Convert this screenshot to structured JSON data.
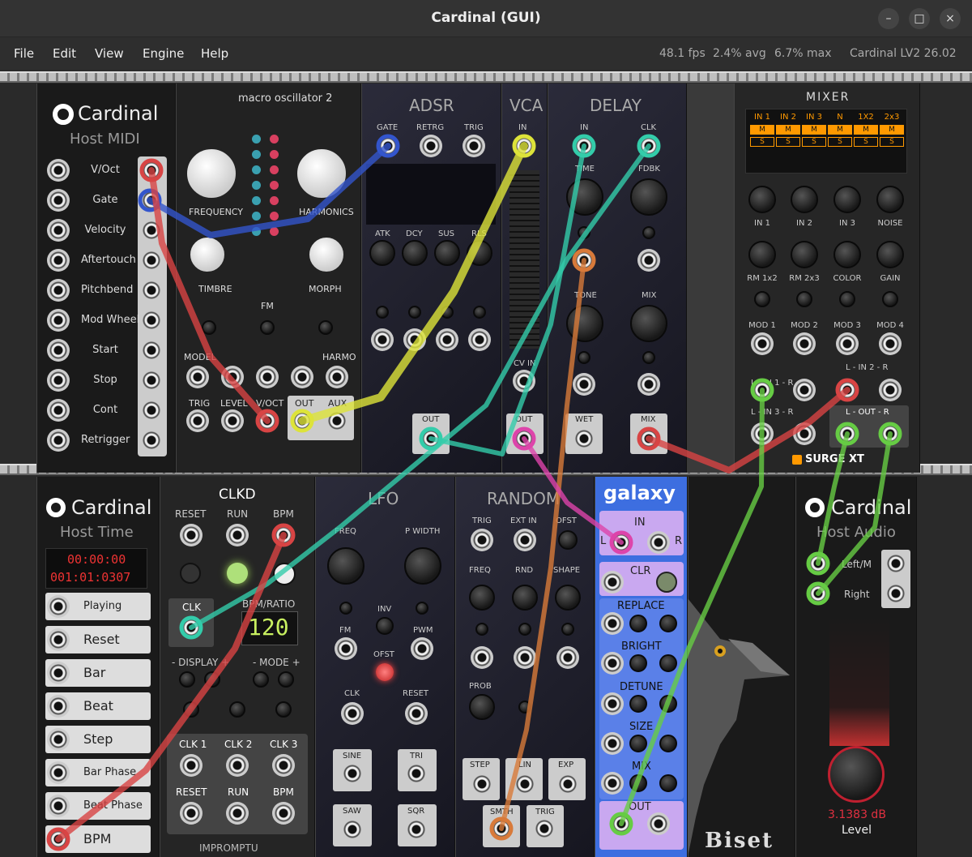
{
  "window": {
    "title": "Cardinal (GUI)",
    "buttons": [
      "–",
      "□",
      "×"
    ]
  },
  "menu": [
    "File",
    "Edit",
    "View",
    "Engine",
    "Help"
  ],
  "status": {
    "fps": "48.1 fps",
    "avg": "2.4% avg",
    "max": "6.7% max",
    "version": "Cardinal LV2 26.02"
  },
  "colors": {
    "red": "#d84444",
    "blue": "#3355cc",
    "yellow": "#dde33a",
    "teal": "#33ccaa",
    "orange": "#d87a3a",
    "green": "#66cc44",
    "pink": "#dd44aa"
  },
  "host_midi": {
    "brand": "Cardinal",
    "title": "Host MIDI",
    "rows": [
      "V/Oct",
      "Gate",
      "Velocity",
      "Aftertouch",
      "Pitchbend",
      "Mod Wheel",
      "Start",
      "Stop",
      "Cont",
      "Retrigger"
    ]
  },
  "macro": {
    "title": "macro oscillator 2",
    "frequency": "FREQUENCY",
    "harmonics": "HARMONICS",
    "timbre": "TIMBRE",
    "morph": "MORPH",
    "fm": "FM",
    "model": "MODEL",
    "harmo": "HARMO",
    "trig": "TRIG",
    "level": "LEVEL",
    "voct": "V/OCT",
    "out": "OUT",
    "aux": "AUX"
  },
  "adsr": {
    "title": "ADSR",
    "gate": "GATE",
    "retrg": "RETRG",
    "trig": "TRIG",
    "atk": "ATK",
    "dcy": "DCY",
    "sus": "SUS",
    "rls": "RLS",
    "out": "OUT"
  },
  "vca": {
    "title": "VCA",
    "in": "IN",
    "cvin": "CV IN",
    "out": "OUT"
  },
  "delay": {
    "title": "DELAY",
    "in": "IN",
    "clk": "CLK",
    "time": "TIME",
    "fdbk": "FDBK",
    "tone": "TONE",
    "mix": "MIX",
    "wet": "WET",
    "mixout": "MIX"
  },
  "mixer": {
    "title": "MIXER",
    "chan": [
      "IN 1",
      "IN 2",
      "IN 3",
      "N",
      "1X2",
      "2x3"
    ],
    "mute": "M",
    "solo": "S",
    "knobs1": [
      "IN 1",
      "IN 2",
      "IN 3",
      "NOISE"
    ],
    "knobs2": [
      "RM 1x2",
      "RM 2x3",
      "COLOR",
      "GAIN"
    ],
    "mods": [
      "MOD 1",
      "MOD 2",
      "MOD 3",
      "MOD 4"
    ],
    "lin1": "L - IN 1 - R",
    "lin2": "L - IN 2 - R",
    "lin3": "L - IN 3 - R",
    "lout": "L - OUT - R",
    "brand": "SURGE XT"
  },
  "host_time": {
    "brand": "Cardinal",
    "title": "Host Time",
    "time": "00:00:00",
    "bbt": "001:01:0307",
    "rows": [
      "Playing",
      "Reset",
      "Bar",
      "Beat",
      "Step",
      "Bar Phase",
      "Beat Phase",
      "BPM"
    ]
  },
  "clkd": {
    "title": "CLKD",
    "reset": "RESET",
    "run": "RUN",
    "bpm": "BPM",
    "clk": "CLK",
    "ratio": "BPM/RATIO",
    "display": "120",
    "disp": "- DISPLAY +",
    "mode": "- MODE +",
    "clk1": "CLK 1",
    "clk2": "CLK 2",
    "clk3": "CLK 3",
    "reset2": "RESET",
    "run2": "RUN",
    "bpm2": "BPM",
    "brand": "IMPROMPTU"
  },
  "lfo": {
    "title": "LFO",
    "freq": "FREQ",
    "pwidth": "P WIDTH",
    "inv": "INV",
    "fm": "FM",
    "pwm": "PWM",
    "ofst": "OFST",
    "clk": "CLK",
    "reset": "RESET",
    "sine": "SINE",
    "tri": "TRI",
    "saw": "SAW",
    "sqr": "SQR"
  },
  "random": {
    "title": "RANDOM",
    "trig": "TRIG",
    "extin": "EXT IN",
    "ofst": "OFST",
    "freq": "FREQ",
    "rnd": "RND",
    "shape": "SHAPE",
    "prob": "PROB",
    "step": "STEP",
    "lin": "LIN",
    "exp": "EXP",
    "smth": "SMTH",
    "trig2": "TRIG"
  },
  "galaxy": {
    "title": "galaxy",
    "in": "IN",
    "l": "L",
    "r": "R",
    "clr": "CLR",
    "replace": "REPLACE",
    "bright": "BRIGHT",
    "detune": "DETUNE",
    "size": "SIZE",
    "mix": "MIX",
    "out": "OUT"
  },
  "host_audio": {
    "brand": "Cardinal",
    "title": "Host Audio",
    "left": "Left/M",
    "right": "Right",
    "db": "3.1383 dB",
    "level": "Level"
  },
  "biset": {
    "logo": "Biset"
  }
}
